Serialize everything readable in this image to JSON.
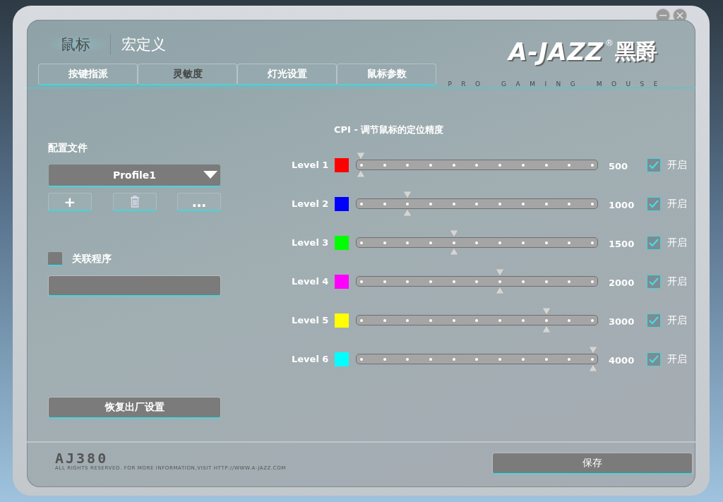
{
  "window_controls": {
    "minimize": "−",
    "close": "×"
  },
  "main_tabs": [
    {
      "label": "鼠标",
      "selected": true
    },
    {
      "label": "宏定义",
      "selected": false
    }
  ],
  "sub_tabs": [
    {
      "label": "按键指派",
      "selected": false
    },
    {
      "label": "灵敏度",
      "selected": true
    },
    {
      "label": "灯光设置",
      "selected": false
    },
    {
      "label": "鼠标参数",
      "selected": false
    }
  ],
  "logo": {
    "brand": "A-JAZZ",
    "registered": "®",
    "chinese": "黑爵",
    "tagline": "PRO GAMING MOUSE"
  },
  "profile": {
    "label": "配置文件",
    "dropdown_value": "Profile1",
    "buttons": [
      "+",
      "…"
    ]
  },
  "link_program": {
    "label": "关联程序",
    "checked": false
  },
  "restore_button": "恢复出厂设置",
  "cpi": {
    "title": "CPI - 调节鼠标的定位精度",
    "levels": [
      {
        "label": "Level 1",
        "color": "#ff0000",
        "level": 0,
        "value": "500",
        "checked": true,
        "check_label": "开启"
      },
      {
        "label": "Level 2",
        "color": "#0000ff",
        "level": 0.2,
        "value": "1000",
        "checked": true,
        "check_label": "开启"
      },
      {
        "label": "Level 3",
        "color": "#00ff00",
        "level": 0.4,
        "value": "1500",
        "checked": true,
        "check_label": "开启"
      },
      {
        "label": "Level 4",
        "color": "#ff00ff",
        "level": 0.6,
        "value": "2000",
        "checked": true,
        "check_label": "开启"
      },
      {
        "label": "Level 5",
        "color": "#ffff00",
        "level": 0.8,
        "value": "3000",
        "checked": true,
        "check_label": "开启"
      },
      {
        "label": "Level 6",
        "color": "#00ffff",
        "level": 1,
        "value": "4000",
        "checked": true,
        "check_label": "开启"
      }
    ]
  },
  "footer": {
    "model": "AJ380",
    "copyright": "ALL RIGHTS RESERVED. FOR MORE INFORMATION,VISIT HTTP://WWW.A-JAZZ.COM",
    "save_button": "保存"
  }
}
